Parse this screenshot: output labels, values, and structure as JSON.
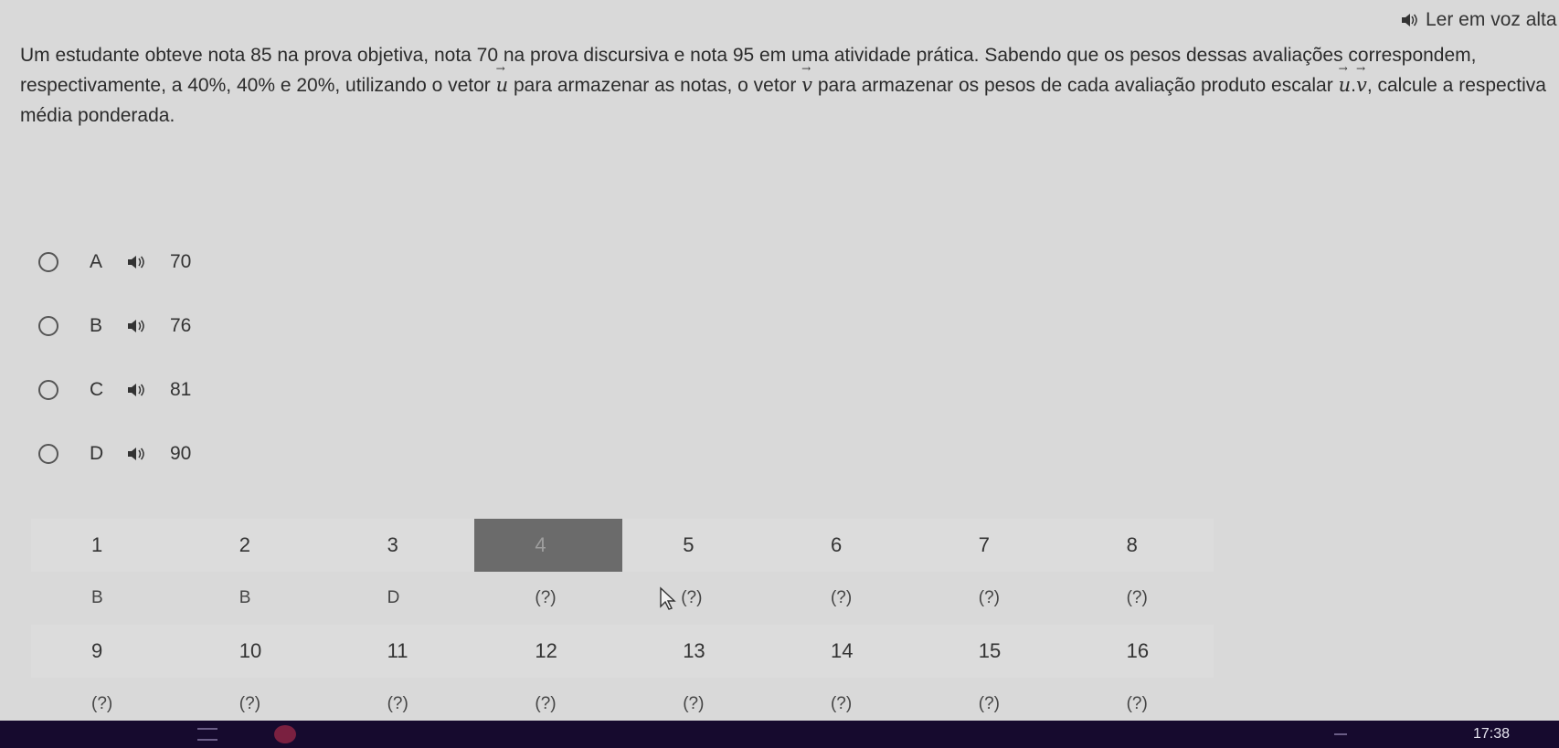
{
  "read_aloud_label": "Ler em voz alta",
  "question": {
    "part1": "Um estudante obteve nota 85 na prova objetiva, nota 70 na prova discursiva e nota 95 em uma atividade prática. Sabendo que os pesos dessas avaliações correspondem, respectivamente, a 40%, 40% e 20%, utilizando o vetor ",
    "vec_u": "u",
    "part2": " para armazenar as notas, o vetor ",
    "vec_v": "v",
    "part3": " para armazenar os pesos de cada avaliação produto escalar ",
    "dot": ".",
    "part4": ", calcule a respectiva média ponderada."
  },
  "options": [
    {
      "letter": "A",
      "value": "70"
    },
    {
      "letter": "B",
      "value": "76"
    },
    {
      "letter": "C",
      "value": "81"
    },
    {
      "letter": "D",
      "value": "90"
    }
  ],
  "answer_grid": {
    "row1": {
      "numbers": [
        "1",
        "2",
        "3",
        "4",
        "5",
        "6",
        "7",
        "8"
      ],
      "answers": [
        "B",
        "B",
        "D",
        "(?)",
        "(?)",
        "(?)",
        "(?)",
        "(?)"
      ]
    },
    "row2": {
      "numbers": [
        "9",
        "10",
        "11",
        "12",
        "13",
        "14",
        "15",
        "16"
      ],
      "answers": [
        "(?)",
        "(?)",
        "(?)",
        "(?)",
        "(?)",
        "(?)",
        "(?)",
        "(?)"
      ]
    },
    "active_question": "4"
  },
  "taskbar": {
    "clock": "17:38"
  },
  "icons": {
    "speaker": "speaker-icon",
    "radio": "radio-button",
    "cursor": "mouse-cursor-icon"
  }
}
